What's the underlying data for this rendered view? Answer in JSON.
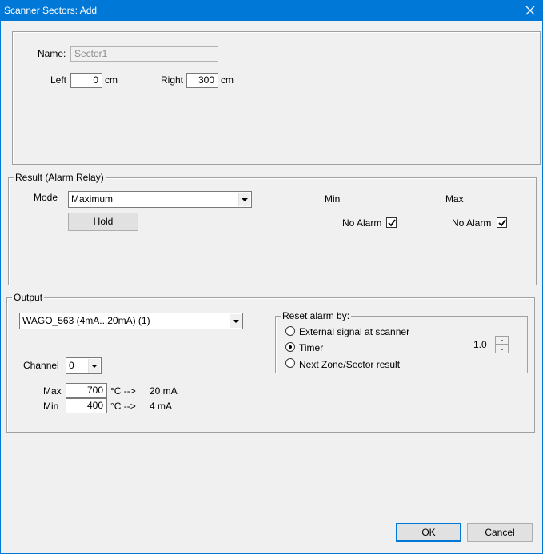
{
  "window": {
    "title": "Scanner Sectors: Add"
  },
  "sector": {
    "name_label": "Name:",
    "name_value": "Sector1",
    "left_label": "Left",
    "left_value": "0",
    "left_unit": "cm",
    "right_label": "Right",
    "right_value": "300",
    "right_unit": "cm"
  },
  "result": {
    "legend": "Result (Alarm Relay)",
    "mode_label": "Mode",
    "mode_value": "Maximum",
    "hold_label": "Hold",
    "min_header": "Min",
    "max_header": "Max",
    "min_no_alarm_label": "No Alarm",
    "min_no_alarm_checked": true,
    "max_no_alarm_label": "No Alarm",
    "max_no_alarm_checked": true
  },
  "output": {
    "legend": "Output",
    "device_value": "WAGO_563 (4mA...20mA) (1)",
    "channel_label": "Channel",
    "channel_value": "0",
    "max_label": "Max",
    "max_value": "700",
    "max_temp_arrow": "°C -->",
    "max_current": "20 mA",
    "min_label": "Min",
    "min_value": "400",
    "min_temp_arrow": "°C -->",
    "min_current": "4 mA",
    "reset": {
      "legend": "Reset alarm by:",
      "options": [
        {
          "label": "External signal at scanner",
          "checked": false
        },
        {
          "label": "Timer",
          "checked": true
        },
        {
          "label": "Next Zone/Sector result",
          "checked": false
        }
      ],
      "timer_value": "1.0"
    }
  },
  "footer": {
    "ok_label": "OK",
    "cancel_label": "Cancel"
  }
}
